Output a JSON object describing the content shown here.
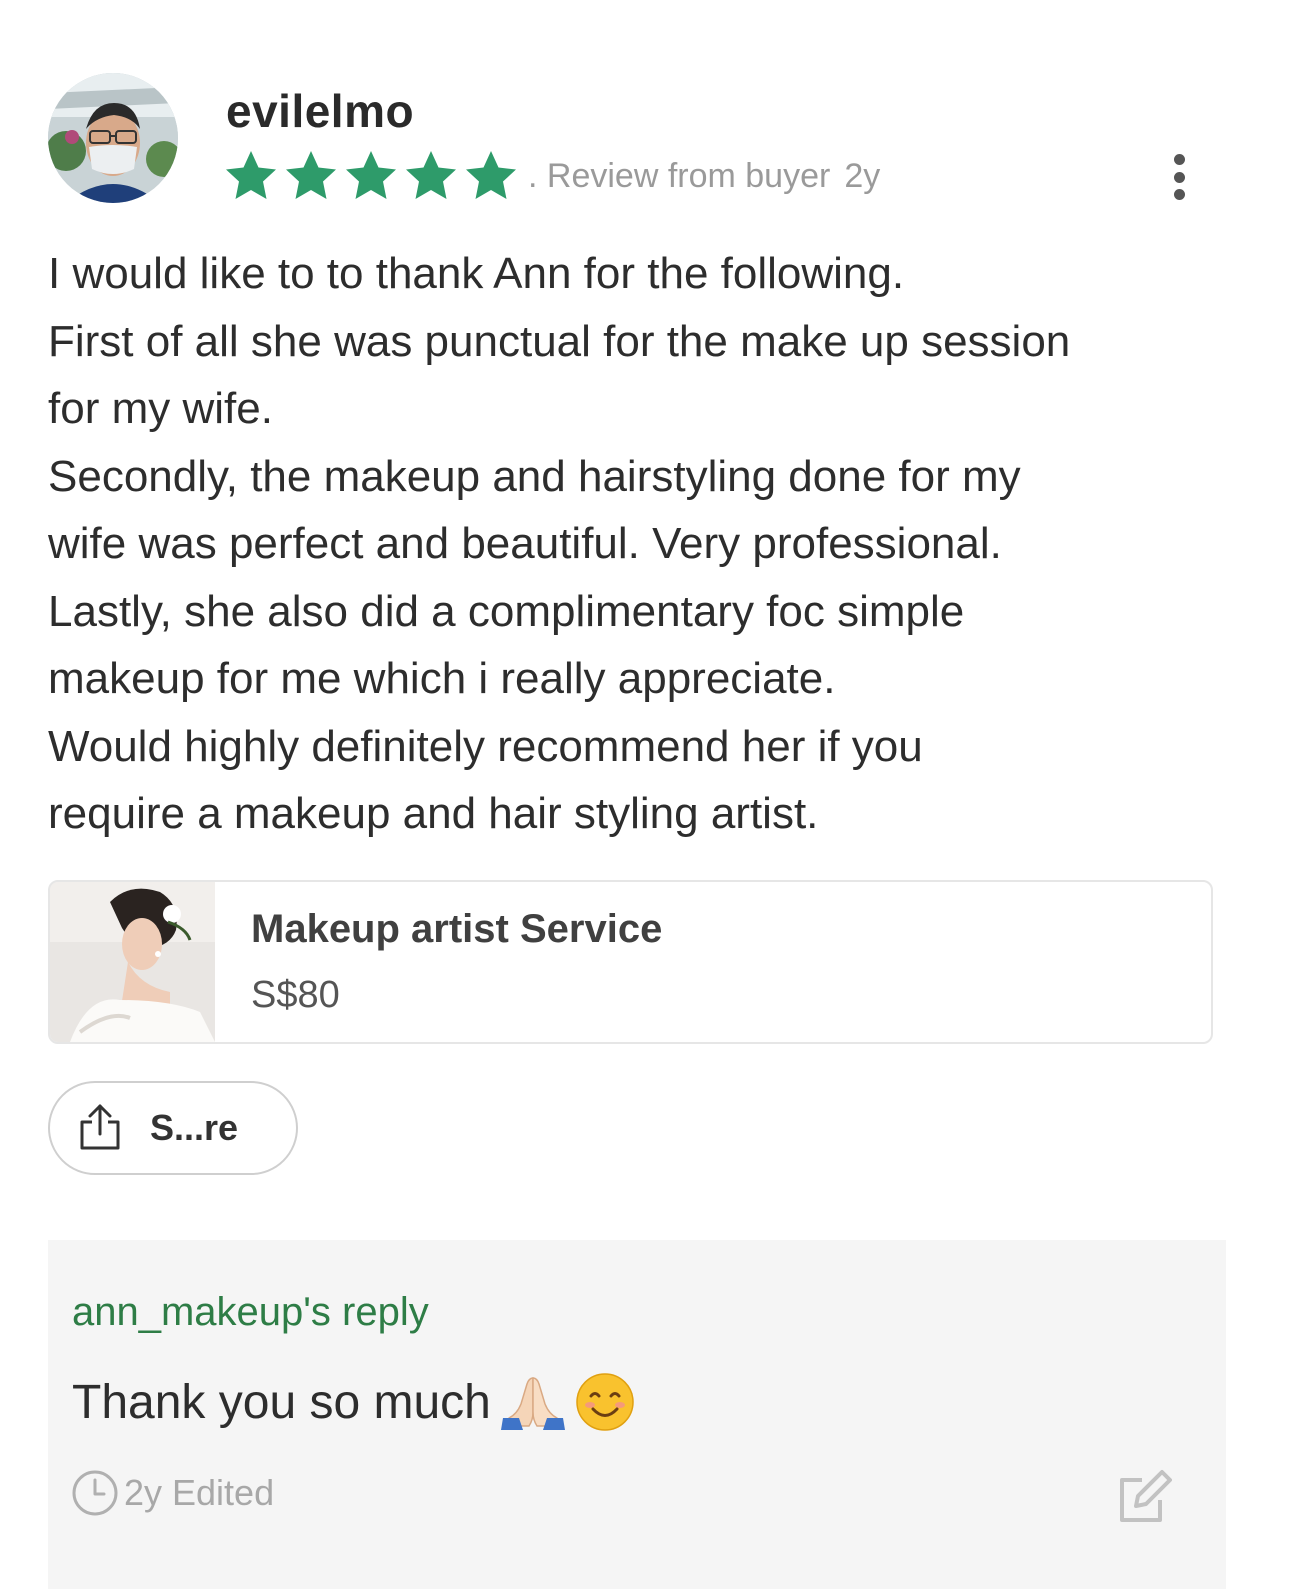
{
  "review": {
    "username": "evilelmo",
    "rating": 5,
    "rating_max": 5,
    "source_label": ". Review from buyer",
    "age": "2y",
    "text_lines": [
      "I would like to to thank Ann for the following.",
      "First of all she was punctual for the make up session",
      "for my wife.",
      "Secondly, the makeup and hairstyling done for my",
      "wife was perfect and beautiful. Very professional.",
      "Lastly, she also did a complimentary foc simple",
      "makeup for me which i really appreciate.",
      "Would highly definitely recommend her if you",
      "require a makeup and hair styling artist."
    ],
    "more_icon": "more-vertical-icon"
  },
  "product": {
    "title": "Makeup artist Service",
    "price": "S$80"
  },
  "share": {
    "label": "S...re",
    "icon": "share-icon"
  },
  "reply": {
    "author_label": "ann_makeup's reply",
    "text": "Thank you so much",
    "emojis": [
      "folded-hands-emoji",
      "smiling-face-emoji"
    ],
    "meta": "2y Edited",
    "clock_icon": "clock-icon",
    "edit_icon": "edit-icon"
  },
  "colors": {
    "star": "#2e9b6a",
    "reply_author": "#2e7d46",
    "reply_background": "#f5f5f5",
    "muted_text": "#9a9a9a"
  }
}
